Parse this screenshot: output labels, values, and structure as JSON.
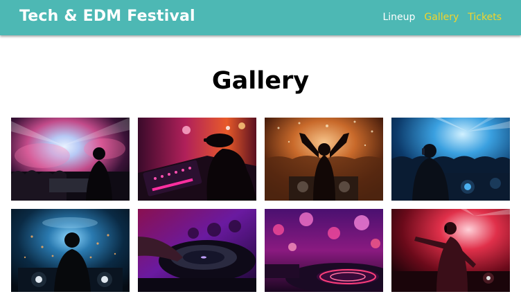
{
  "brand": "Tech & EDM Festival",
  "nav": [
    {
      "label": "Lineup",
      "color": "#ffffff"
    },
    {
      "label": "Gallery",
      "color": "#f3d42a"
    },
    {
      "label": "Tickets",
      "color": "#f3d42a"
    }
  ],
  "page_title": "Gallery",
  "colors": {
    "navbar_bg": "#4db8b4",
    "accent": "#f3d42a"
  },
  "gallery": [
    {
      "subject": "dj-silhouette-pink-smoke-stage"
    },
    {
      "subject": "dj-cap-mixer-pink-lights"
    },
    {
      "subject": "dj-arms-raised-orange-crowd"
    },
    {
      "subject": "dj-headphones-blue-crowd"
    },
    {
      "subject": "dj-back-view-blue-lights"
    },
    {
      "subject": "turntable-closeup-purple"
    },
    {
      "subject": "blurred-decks-magenta"
    },
    {
      "subject": "dj-headphones-red-stage"
    }
  ]
}
